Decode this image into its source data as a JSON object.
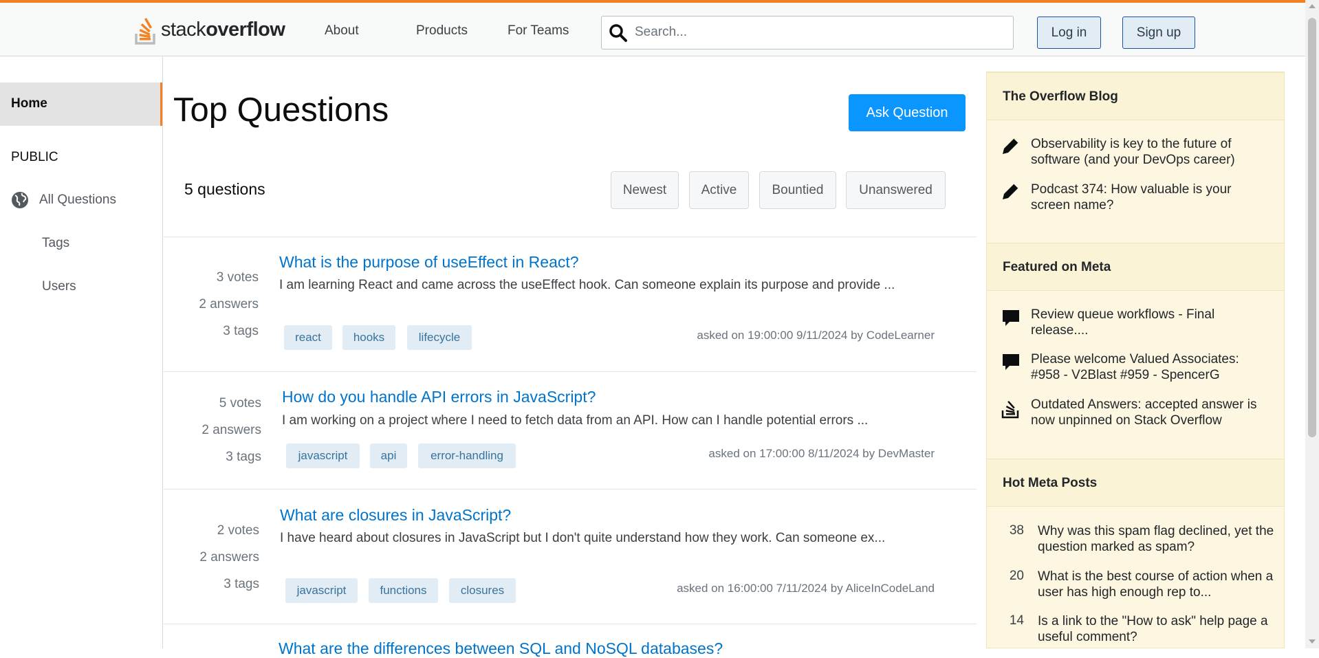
{
  "header": {
    "logo_light": "stack",
    "logo_bold": "overflow",
    "nav": [
      "About",
      "Products",
      "For Teams"
    ],
    "search_placeholder": "Search...",
    "login_label": "Log in",
    "signup_label": "Sign up",
    "accent_color": "#f48225"
  },
  "sidebar": {
    "home": "Home",
    "section": "PUBLIC",
    "all_questions": "All Questions",
    "tags": "Tags",
    "users": "Users"
  },
  "main": {
    "title": "Top Questions",
    "ask_label": "Ask Question",
    "count_label": "5 questions",
    "filters": [
      "Newest",
      "Active",
      "Bountied",
      "Unanswered"
    ],
    "questions": [
      {
        "votes": "3 votes",
        "answers": "2 answers",
        "tag_count": "3 tags",
        "title": "What is the purpose of useEffect in React?",
        "excerpt": "I am learning React and came across the useEffect hook. Can someone explain its purpose and provide ...",
        "tags": [
          "react",
          "hooks",
          "lifecycle"
        ],
        "meta": "asked on 19:00:00 9/11/2024 by CodeLearner"
      },
      {
        "votes": "5 votes",
        "answers": "2 answers",
        "tag_count": "3 tags",
        "title": "How do you handle API errors in JavaScript?",
        "excerpt": "I am working on a project where I need to fetch data from an API. How can I handle potential errors ...",
        "tags": [
          "javascript",
          "api",
          "error-handling"
        ],
        "meta": "asked on 17:00:00 8/11/2024 by DevMaster"
      },
      {
        "votes": "2 votes",
        "answers": "2 answers",
        "tag_count": "3 tags",
        "title": "What are closures in JavaScript?",
        "excerpt": "I have heard about closures in JavaScript but I don't quite understand how they work. Can someone ex...",
        "tags": [
          "javascript",
          "functions",
          "closures"
        ],
        "meta": "asked on 16:00:00 7/11/2024 by AliceInCodeLand"
      },
      {
        "title": "What are the differences between SQL and NoSQL databases?"
      }
    ]
  },
  "right": {
    "blog_title": "The Overflow Blog",
    "blog_items": [
      "Observability is key to the future of software (and your DevOps career)",
      "Podcast 374: How valuable is your screen name?"
    ],
    "meta_title": "Featured on Meta",
    "meta_items": [
      "Review queue workflows - Final release....",
      "Please welcome Valued Associates: #958 - V2Blast #959 - SpencerG",
      "Outdated Answers: accepted answer is now unpinned on Stack Overflow"
    ],
    "hot_title": "Hot Meta Posts",
    "hot_posts": [
      {
        "count": "38",
        "text": "Why was this spam flag declined, yet the question marked as spam?"
      },
      {
        "count": "20",
        "text": "What is the best course of action when a user has high enough rep to..."
      },
      {
        "count": "14",
        "text": "Is a link to the \"How to ask\" help page a useful comment?"
      }
    ]
  }
}
